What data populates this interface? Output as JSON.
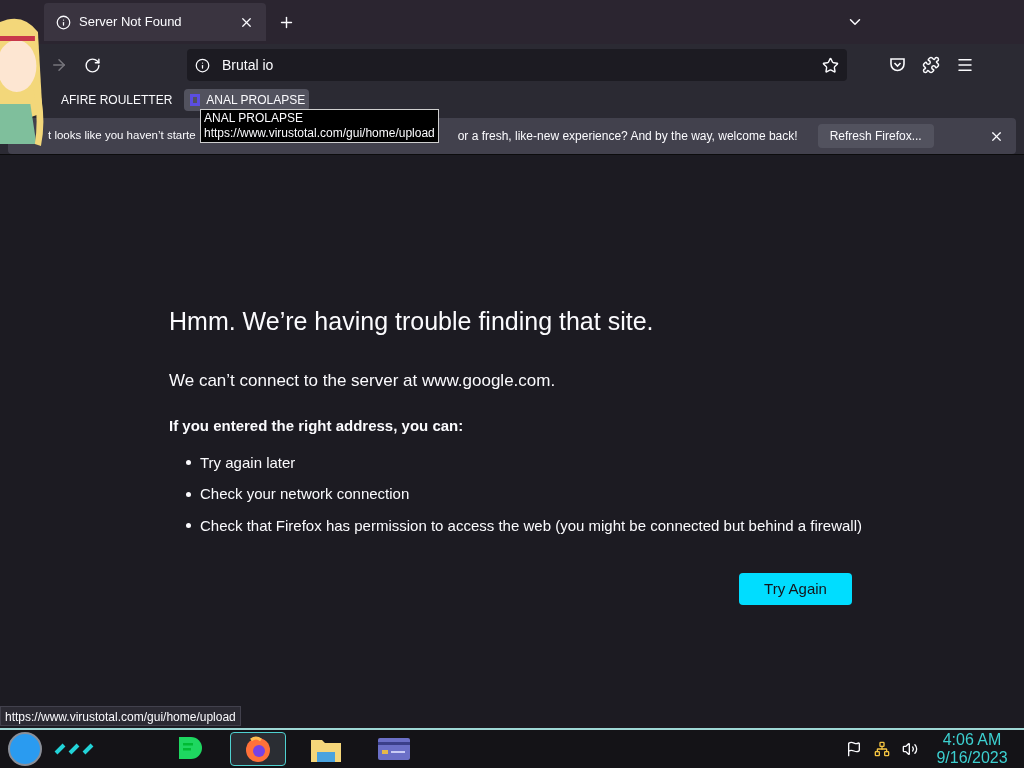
{
  "tabs": [
    {
      "title": "Server Not Found",
      "selected": true
    }
  ],
  "address_bar": {
    "value": "Brutal io"
  },
  "bookmarks": [
    {
      "label": "AFIRE ROULETTER",
      "hovered": false
    },
    {
      "label": "ANAL PROLAPSE",
      "hovered": true
    }
  ],
  "tooltip": {
    "title": "ANAL PROLAPSE",
    "url": "https://www.virustotal.com/gui/home/upload"
  },
  "notification": {
    "text_before": "t looks like you haven’t starte",
    "text_after": "or a fresh, like-new experience? And by the way, welcome back!",
    "button": "Refresh Firefox..."
  },
  "error_page": {
    "title": "Hmm. We’re having trouble finding that site.",
    "message": "We can’t connect to the server at www.google.com.",
    "advice_heading": "If you entered the right address, you can:",
    "suggestions": [
      "Try again later",
      "Check your network connection",
      "Check that Firefox has permission to access the web (you might be connected but behind a firewall)"
    ],
    "button": "Try Again"
  },
  "status_url": "https://www.virustotal.com/gui/home/upload",
  "taskbar": {
    "apps": [
      {
        "kind": "chat",
        "selected": false
      },
      {
        "kind": "browser",
        "selected": true
      },
      {
        "kind": "folder",
        "selected": false
      },
      {
        "kind": "card",
        "selected": false
      }
    ],
    "clock": {
      "time": "4:06 AM",
      "date": "9/16/2023"
    }
  }
}
